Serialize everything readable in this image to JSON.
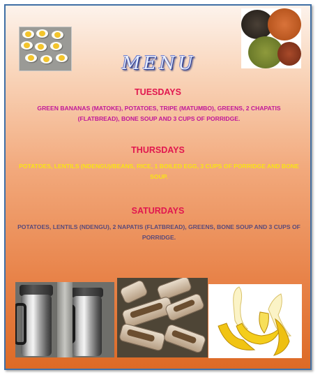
{
  "menu": {
    "title": "MENU",
    "days": [
      {
        "name": "TUESDAYS",
        "items": "GREEN BANANAS (MATOKE), POTATOES, TRIPE (MATUMBO), GREENS, 2 CHAPATIS (FLATBREAD), BONE SOUP AND 3 CUPS OF PORRIDGE."
      },
      {
        "name": "THURSDAYS",
        "items": "POTATOES, LENTILS (NDENGU)/BEANS, RICE, 1 BOILED EGG, 3 CUPS OF PORRIDGE AND BONE SOUP."
      },
      {
        "name": "SATURDAYS",
        "items": "POTATOES, LENTILS (NDENGU), 2 NAPATIS (FLATBREAD), GREENS, BONE SOUP  AND 3 CUPS OF PORRIDGE."
      }
    ]
  },
  "colors": {
    "day_heading": "#e1174f",
    "tuesday_items": "#c0179a",
    "thursday_items": "#f9e414",
    "saturday_items": "#5a4a7a",
    "frame_border": "#3f6fa5"
  },
  "images": [
    "boiled-eggs-photo",
    "lentils-spices-photo",
    "thermos-flasks-photo",
    "bone-marrow-photo",
    "bananas-photo"
  ]
}
